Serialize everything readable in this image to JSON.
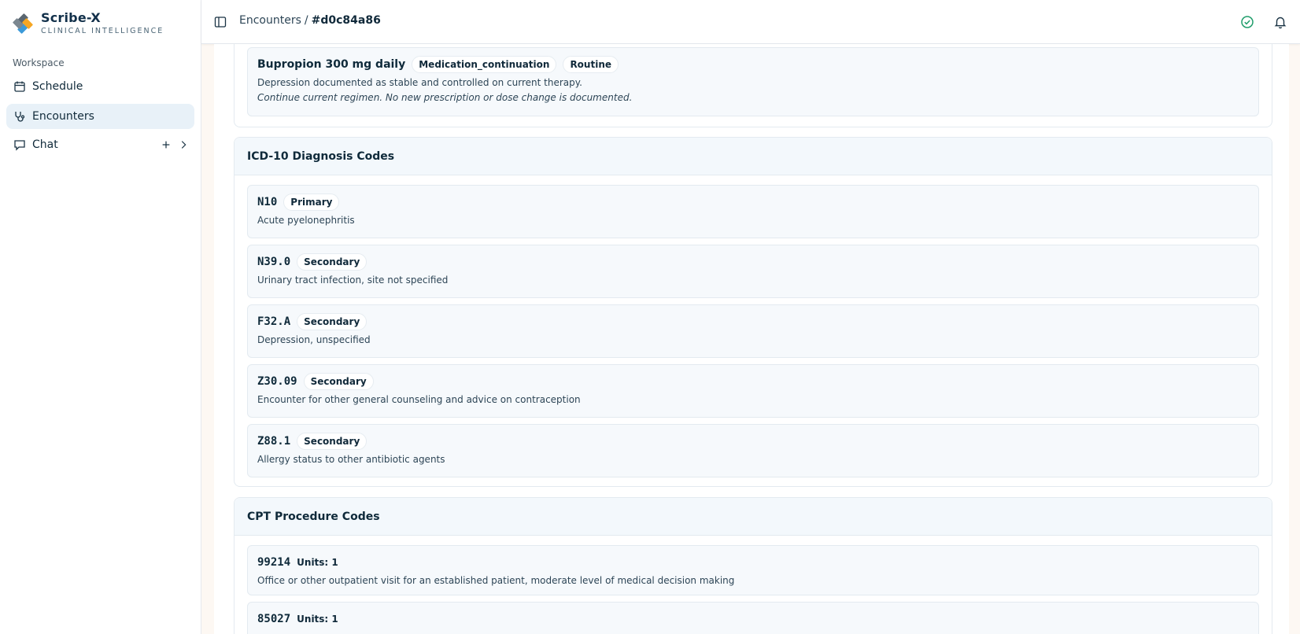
{
  "brand": {
    "name": "Scribe-X",
    "tagline": "CLINICAL INTELLIGENCE"
  },
  "sidebar": {
    "section_label": "Workspace",
    "items": [
      {
        "label": "Schedule",
        "icon": "calendar-icon"
      },
      {
        "label": "Encounters",
        "icon": "stethoscope-icon",
        "active": true
      },
      {
        "label": "Chat",
        "icon": "chat-icon"
      }
    ]
  },
  "header": {
    "breadcrumb_root": "Encounters",
    "breadcrumb_sep": "/",
    "breadcrumb_current": "#d0c84a86"
  },
  "medication": {
    "name": "Bupropion 300 mg daily",
    "type": "Medication_continuation",
    "priority": "Routine",
    "description": "Depression documented as stable and controlled on current therapy.",
    "note": "Continue current regimen. No new prescription or dose change is documented."
  },
  "icd": {
    "title": "ICD-10 Diagnosis Codes",
    "codes": [
      {
        "code": "N10",
        "rank": "Primary",
        "description": "Acute pyelonephritis"
      },
      {
        "code": "N39.0",
        "rank": "Secondary",
        "description": "Urinary tract infection, site not specified"
      },
      {
        "code": "F32.A",
        "rank": "Secondary",
        "description": "Depression, unspecified"
      },
      {
        "code": "Z30.09",
        "rank": "Secondary",
        "description": "Encounter for other general counseling and advice on contraception"
      },
      {
        "code": "Z88.1",
        "rank": "Secondary",
        "description": "Allergy status to other antibiotic agents"
      }
    ]
  },
  "cpt": {
    "title": "CPT Procedure Codes",
    "codes": [
      {
        "code": "99214",
        "units": "Units: 1",
        "description": "Office or other outpatient visit for an established patient, moderate level of medical decision making"
      },
      {
        "code": "85027",
        "units": "Units: 1",
        "description": ""
      }
    ]
  },
  "colors": {
    "accent": "#e8f1f8",
    "ok": "#1f9d6b",
    "logo_orange": "#f5a623",
    "logo_blue": "#3b9ad9",
    "logo_dark": "#5a6670"
  }
}
